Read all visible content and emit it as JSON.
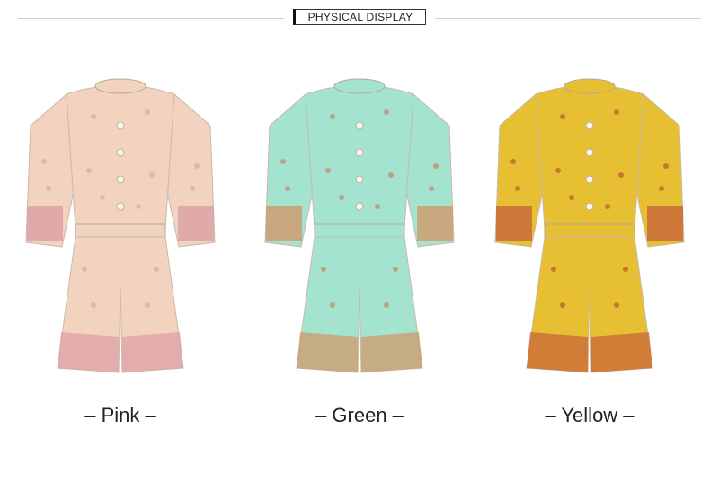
{
  "header": {
    "title": "PHYSICAL DISPLAY"
  },
  "products": [
    {
      "label": "– Pink –",
      "color": "#f1d3bf",
      "accent": "#e7a2a8",
      "band": "#dca0a6",
      "icon": "romper-garment-icon"
    },
    {
      "label": "– Green –",
      "color": "#a4e3cf",
      "accent": "#c88462",
      "band": "#d19a6a",
      "icon": "romper-garment-icon"
    },
    {
      "label": "– Yellow –",
      "color": "#e6bf32",
      "accent": "#b65a2c",
      "band": "#c7673a",
      "icon": "romper-garment-icon"
    }
  ]
}
